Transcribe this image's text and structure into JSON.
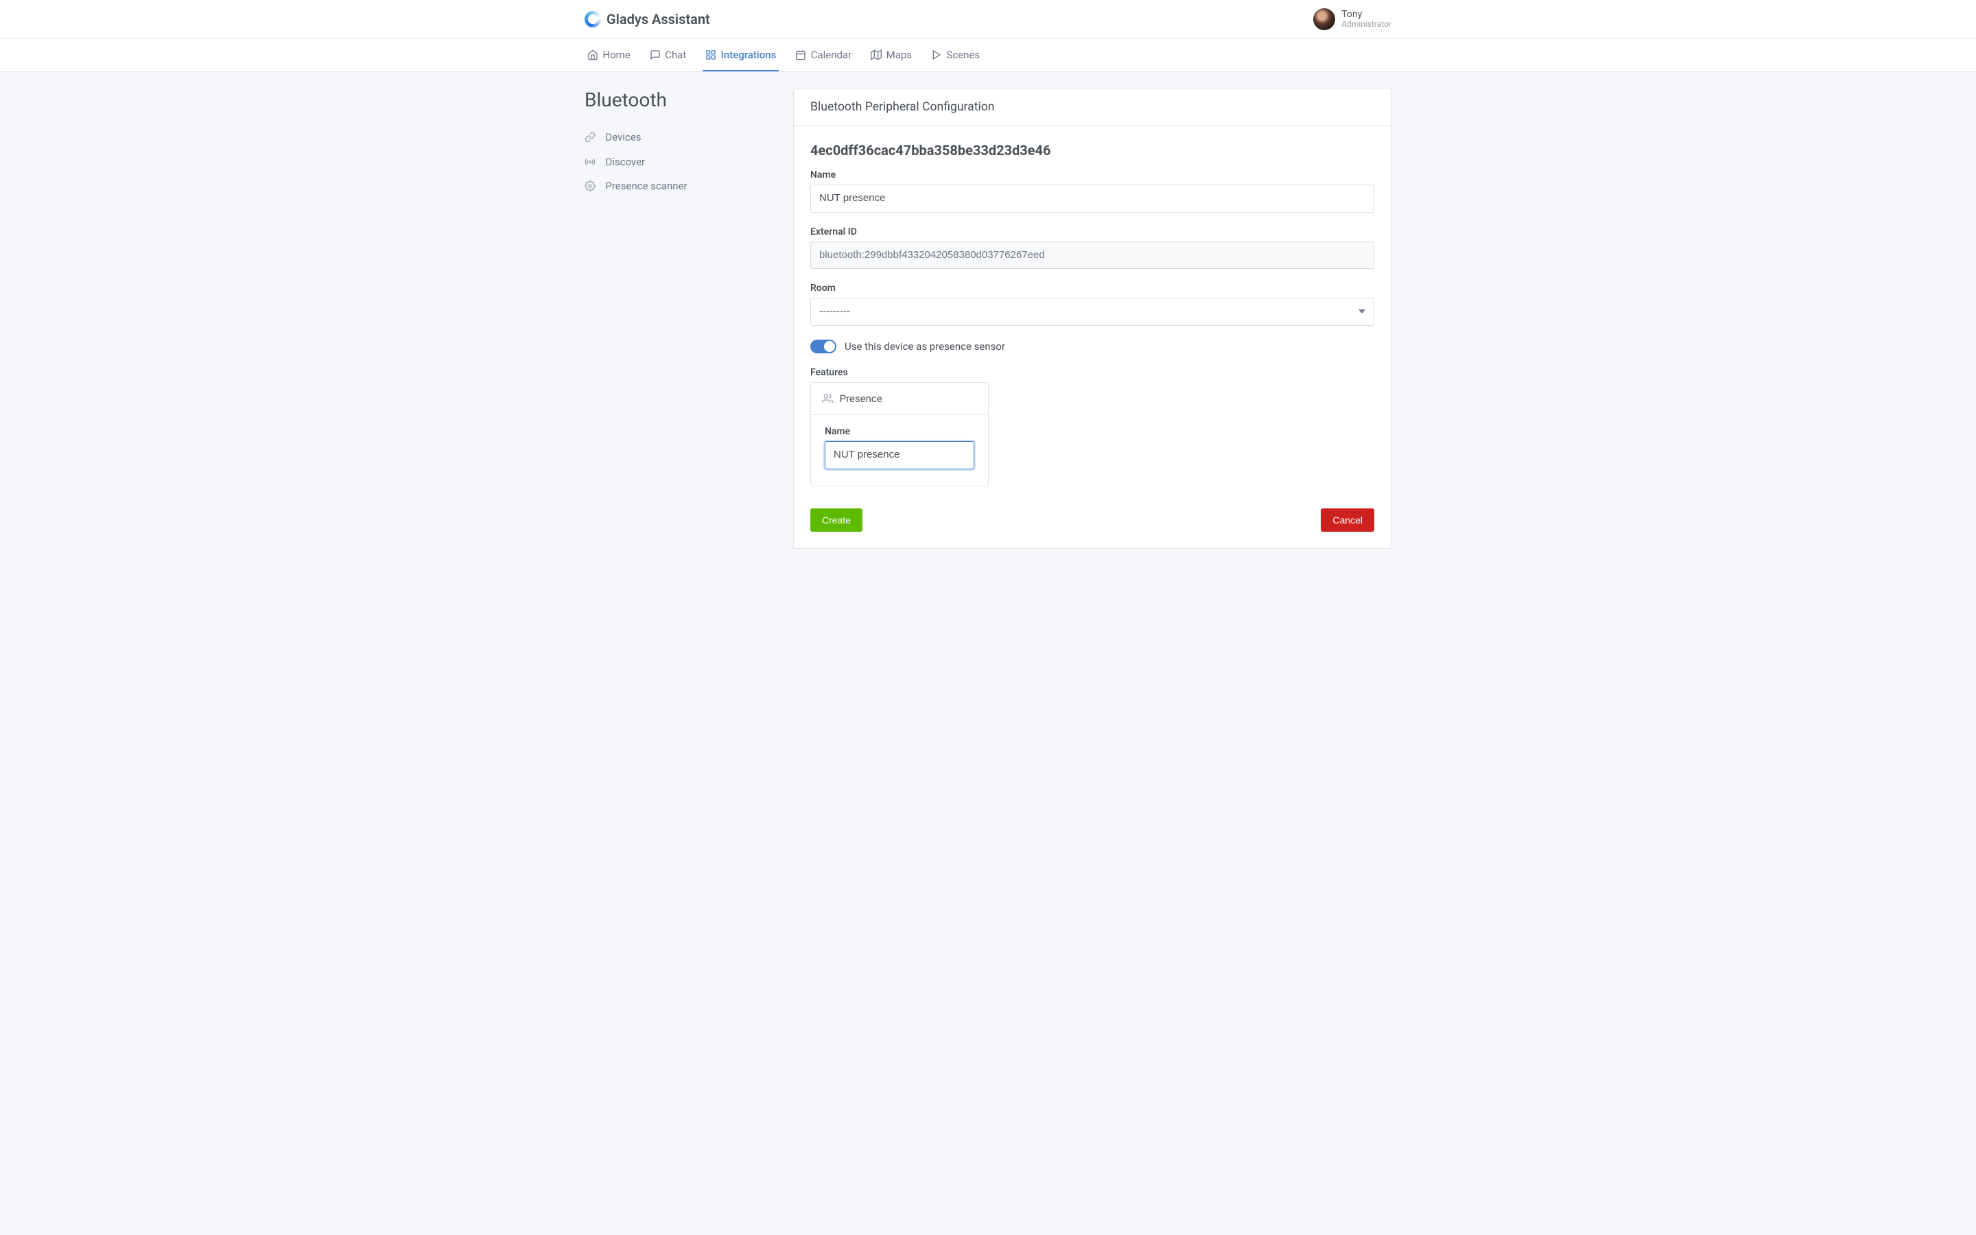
{
  "brand": "Gladys Assistant",
  "user": {
    "name": "Tony",
    "role": "Administrator"
  },
  "nav": {
    "home": "Home",
    "chat": "Chat",
    "integrations": "Integrations",
    "calendar": "Calendar",
    "maps": "Maps",
    "scenes": "Scenes"
  },
  "sidebar": {
    "title": "Bluetooth",
    "items": {
      "devices": "Devices",
      "discover": "Discover",
      "presence_scanner": "Presence scanner"
    }
  },
  "card": {
    "title": "Bluetooth Peripheral Configuration",
    "device_id": "4ec0dff36cac47bba358be33d23d3e46",
    "labels": {
      "name": "Name",
      "external_id": "External ID",
      "room": "Room",
      "features": "Features"
    },
    "fields": {
      "name": "NUT presence",
      "external_id": "bluetooth:299dbbf4332042058380d03776267eed",
      "room_placeholder": "---------"
    },
    "presence_toggle_label": "Use this device as presence sensor",
    "presence_toggle_on": true,
    "feature": {
      "title": "Presence",
      "name_label": "Name",
      "name_value": "NUT presence"
    },
    "buttons": {
      "create": "Create",
      "cancel": "Cancel"
    }
  }
}
